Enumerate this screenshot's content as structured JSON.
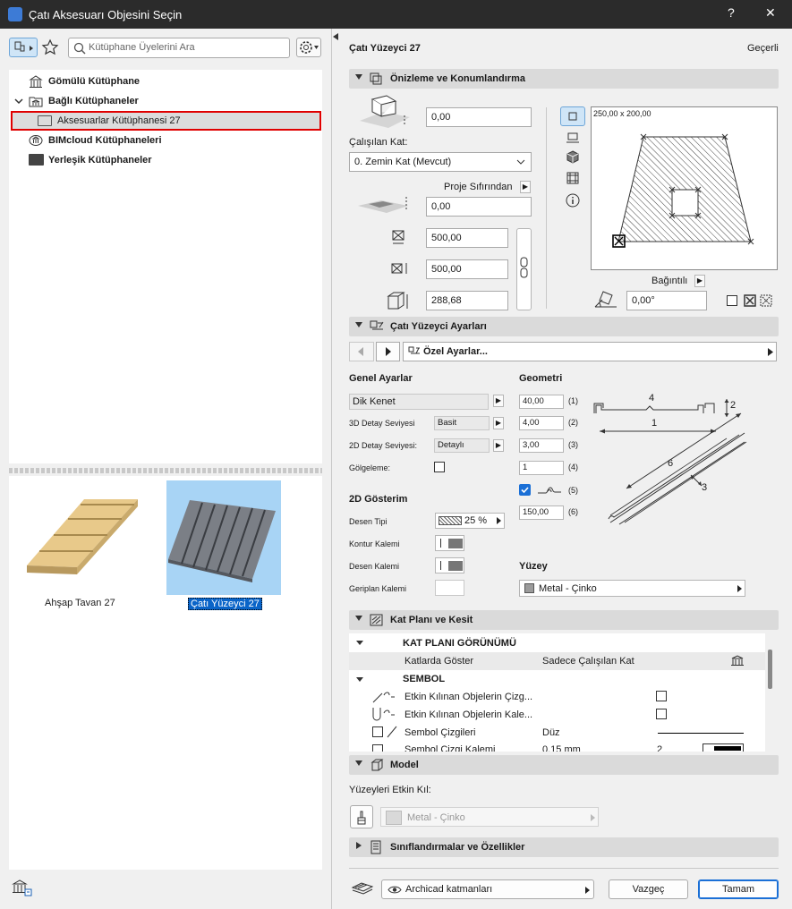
{
  "window": {
    "title": "Çatı Aksesuarı Objesini Seçin",
    "help": "?",
    "close": "✕"
  },
  "left": {
    "search_placeholder": "Kütüphane Üyelerini Ara",
    "tree": [
      {
        "label": "Gömülü Kütüphane"
      },
      {
        "label": "Bağlı Kütüphaneler"
      },
      {
        "label": "Aksesuarlar Kütüphanesi 27"
      },
      {
        "label": "BIMcloud Kütüphaneleri"
      },
      {
        "label": "Yerleşik Kütüphaneler"
      }
    ],
    "thumbs": [
      {
        "label": "Ahşap Tavan 27"
      },
      {
        "label": "Çatı Yüzeyci 27"
      }
    ]
  },
  "right": {
    "object_name": "Çatı Yüzeyci 27",
    "current_label": "Geçerli",
    "preview": {
      "header": "Önizleme ve Konumlandırma",
      "offset": "0,00",
      "story_label": "Çalışılan Kat:",
      "story_value": "0. Zemin Kat (Mevcut)",
      "project_zero_label": "Proje Sıfırından",
      "project_zero_value": "0,00",
      "width": "500,00",
      "length": "500,00",
      "height": "288,68",
      "preview_size": "250,00 x 200,00",
      "relative_label": "Bağıntılı",
      "angle": "0,00°"
    },
    "settings": {
      "header": "Çatı Yüzeyci Ayarları",
      "page": "Özel Ayarlar...",
      "general_title": "Genel Ayarlar",
      "general_value": "Dik Kenet",
      "detail3d_label": "3D Detay Seviyesi",
      "detail3d_value": "Basit",
      "detail2d_label": "2D Detay Seviyesi:",
      "detail2d_value": "Detaylı",
      "shadow_label": "Gölgeleme:",
      "disp2d_title": "2D Gösterim",
      "pattern_type_label": "Desen Tipi",
      "pattern_value": "25 %",
      "contour_pen_label": "Kontur Kalemi",
      "pattern_pen_label": "Desen Kalemi",
      "bg_pen_label": "Geriplan Kalemi",
      "geometry_title": "Geometri",
      "geom": [
        {
          "value": "40,00",
          "idx": "(1)"
        },
        {
          "value": "4,00",
          "idx": "(2)"
        },
        {
          "value": "3,00",
          "idx": "(3)"
        },
        {
          "value": "1",
          "idx": "(4)"
        },
        {
          "value": "",
          "idx": "(5)"
        },
        {
          "value": "150,00",
          "idx": "(6)"
        }
      ],
      "diagram_labels": {
        "a": "4",
        "b": "2",
        "c": "1",
        "d": "6",
        "e": "3"
      },
      "surface_title": "Yüzey",
      "surface_value": "Metal - Çinko"
    },
    "floorplan": {
      "header": "Kat Planı ve Kesit",
      "group1": "KAT PLANI GÖRÜNÜMÜ",
      "rows": [
        {
          "label": "Katlarda Göster",
          "value": "Sadece Çalışılan Kat"
        }
      ],
      "group2": "SEMBOL",
      "rows2": [
        {
          "label": "Etkin Kılınan Objelerin Çizg..."
        },
        {
          "label": "Etkin Kılınan Objelerin Kale..."
        },
        {
          "label": "Sembol Çizgileri",
          "value": "Düz"
        },
        {
          "label": "Sembol Çizgi Kalemi",
          "value": "0,15 mm",
          "extra": "2"
        }
      ]
    },
    "model": {
      "header": "Model",
      "surfaces_label": "Yüzeyleri Etkin Kıl:",
      "surface_value": "Metal - Çinko"
    },
    "classif": {
      "header": "Sınıflandırmalar ve Özellikler"
    },
    "footer": {
      "layer": "Archicad katmanları",
      "cancel": "Vazgeç",
      "ok": "Tamam"
    }
  }
}
